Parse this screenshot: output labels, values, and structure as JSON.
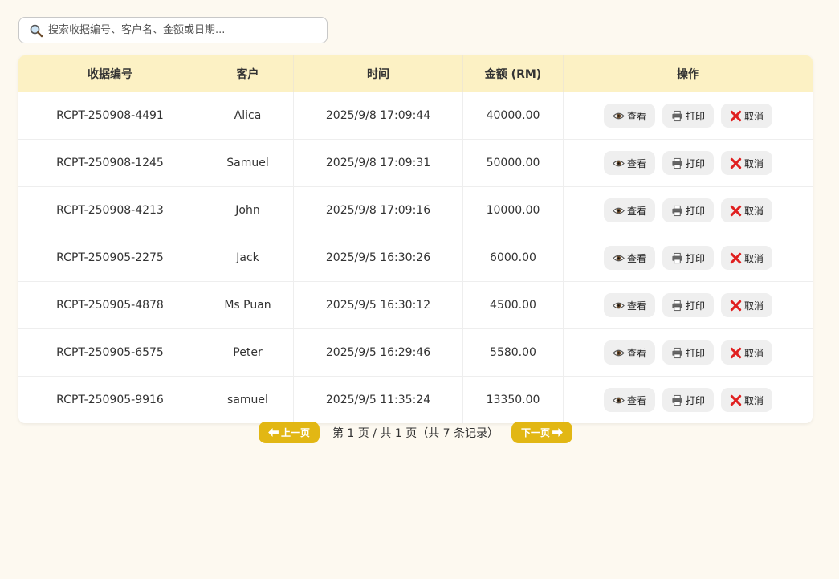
{
  "search": {
    "placeholder": "搜索收据编号、客户名、金额或日期..."
  },
  "table": {
    "headers": [
      "收据编号",
      "客户",
      "时间",
      "金额 (RM)",
      "操作"
    ],
    "rows": [
      {
        "id": "RCPT-250908-4491",
        "customer": "Alica",
        "time": "2025/9/8 17:09:44",
        "amount": "40000.00"
      },
      {
        "id": "RCPT-250908-1245",
        "customer": "Samuel",
        "time": "2025/9/8 17:09:31",
        "amount": "50000.00"
      },
      {
        "id": "RCPT-250908-4213",
        "customer": "John",
        "time": "2025/9/8 17:09:16",
        "amount": "10000.00"
      },
      {
        "id": "RCPT-250905-2275",
        "customer": "Jack",
        "time": "2025/9/5 16:30:26",
        "amount": "6000.00"
      },
      {
        "id": "RCPT-250905-4878",
        "customer": "Ms Puan",
        "time": "2025/9/5 16:30:12",
        "amount": "4500.00"
      },
      {
        "id": "RCPT-250905-6575",
        "customer": "Peter",
        "time": "2025/9/5 16:29:46",
        "amount": "5580.00"
      },
      {
        "id": "RCPT-250905-9916",
        "customer": "samuel",
        "time": "2025/9/5 11:35:24",
        "amount": "13350.00"
      }
    ],
    "actions": {
      "view": "查看",
      "print": "打印",
      "cancel": "取消"
    }
  },
  "pager": {
    "prev_label": "上一页",
    "next_label": "下一页",
    "info": "第 1 页 / 共 1 页（共 7 条记录）"
  },
  "colors": {
    "background": "#fdf9f0",
    "header_bg": "#fcf1c4",
    "pager_button": "#e2b714",
    "action_bg": "#efefef",
    "cancel_red": "#e02020"
  },
  "icons": {
    "search": "magnifier-icon",
    "view": "eye-icon",
    "print": "printer-icon",
    "cancel": "cross-mark-icon",
    "prev": "arrow-left-icon",
    "next": "arrow-right-icon"
  }
}
